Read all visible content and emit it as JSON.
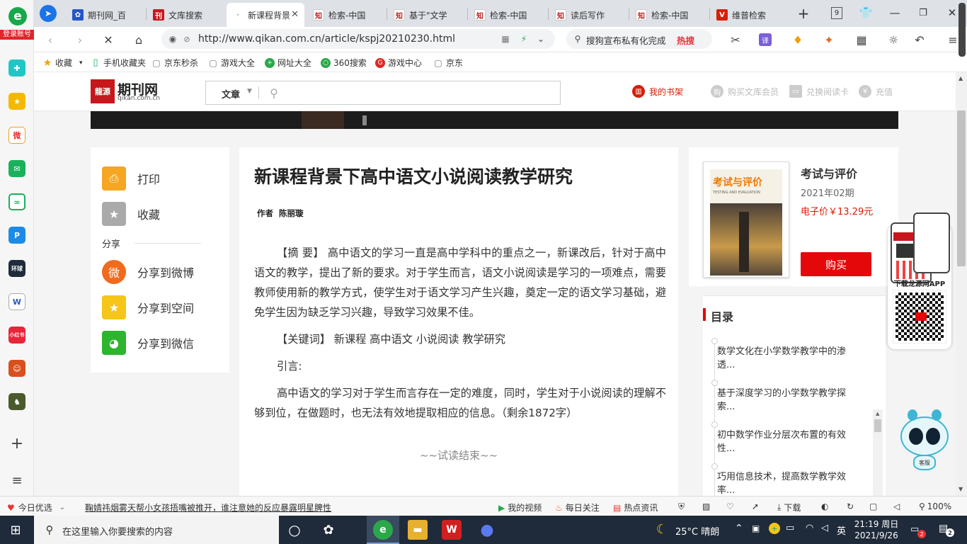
{
  "sidebar": {
    "login_label": "登录账号",
    "icons": [
      "plus-cross-icon",
      "star-icon",
      "weibo-icon",
      "mail-icon",
      "link-icon",
      "p-icon",
      "game-icon",
      "word-icon",
      "xiaohongshu-icon",
      "game-character-icon",
      "game-icon-2",
      "add-icon",
      "list-icon"
    ],
    "xhs_label": "小红书"
  },
  "tabs": [
    {
      "title": "期刊网_百",
      "active": false
    },
    {
      "title": "文库搜索",
      "active": false
    },
    {
      "title": "新课程背景",
      "active": true
    },
    {
      "title": "检索-中国",
      "active": false
    },
    {
      "title": "基于\"文学",
      "active": false
    },
    {
      "title": "检索-中国",
      "active": false
    },
    {
      "title": "读后写作",
      "active": false
    },
    {
      "title": "检索-中国",
      "active": false
    },
    {
      "title": "维普检索",
      "active": false
    }
  ],
  "tab_count": "9",
  "address": {
    "url": "http://www.qikan.com.cn/article/kspj20210230.html",
    "search_text": "搜狗宣布私有化完成",
    "search_hot": "热搜",
    "translate_label": "译"
  },
  "bookmarks": [
    "收藏",
    "手机收藏夹",
    "京东秒杀",
    "游戏大全",
    "网址大全",
    "360搜索",
    "游戏中心",
    "京东"
  ],
  "site": {
    "logo_title": "期刊网",
    "logo_url": "qikan.com.cn",
    "search_category": "文章",
    "my_shelf": "我的书架",
    "buy_member": "购买文库会员",
    "redeem_card": "兑换阅读卡",
    "recharge": "充值"
  },
  "share": {
    "print": "打印",
    "favorite": "收藏",
    "share_heading": "分享",
    "weibo": "分享到微博",
    "qzone": "分享到空间",
    "wechat": "分享到微信"
  },
  "article": {
    "title": "新课程背景下高中语文小说阅读教学研究",
    "author_label": "作者",
    "author": "陈丽璇",
    "abstract": "【摘 要】 高中语文的学习一直是高中学科中的重点之一，新课改后，针对于高中语文的教学，提出了新的要求。对于学生而言，语文小说阅读是学习的一项难点，需要教师使用新的教学方式，使学生对于语文学习产生兴趣，奠定一定的语文学习基础，避免学生因为缺乏学习兴趣，导致学习效果不佳。",
    "keywords": "【关键词】 新课程  高中语文  小说阅读  教学研究",
    "intro_label": "引言:",
    "intro_text": "高中语文的学习对于学生而言存在一定的难度，同时，学生对于小说阅读的理解不够到位，在做题时，也无法有效地提取相应的信息。（剩余1872字）",
    "trial_end": "~~试读结束~~"
  },
  "journal": {
    "name": "考试与评价",
    "issue": "2021年02期",
    "price": "电子价￥13.29元",
    "buy_label": "购买",
    "cover_title": "考试与评价",
    "cover_subtitle": "TESTING AND EVALUATION"
  },
  "toc": {
    "heading": "目录",
    "items": [
      "数学文化在小学数学教学中的渗透...",
      "基于深度学习的小学数学教学探索...",
      "初中数学作业分层次布置的有效性...",
      "巧用信息技术，提高数学教学效率..."
    ]
  },
  "qr": {
    "label": "下载龙源网APP",
    "mascot_label": "客服"
  },
  "statusbar": {
    "today": "今日优选",
    "news": "鞠婧祎烟雾天帮小女孩捂嘴被推开，谁注意她的反应暴露明星脾性",
    "video": "我的视频",
    "daily": "每日关注",
    "hot": "热点资讯",
    "download": "下载",
    "zoom": "100%"
  },
  "taskbar": {
    "search_placeholder": "在这里输入你要搜索的内容",
    "weather": "25°C 晴朗",
    "ime": "英",
    "time": "21:19 周日",
    "date": "2021/9/26",
    "notif_count": "2",
    "mail_badge": "2"
  }
}
